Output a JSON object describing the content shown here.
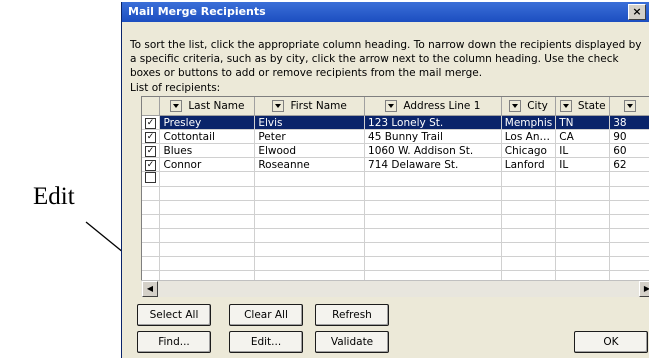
{
  "callout": {
    "text": "Edit"
  },
  "dialog": {
    "title": "Mail Merge Recipients",
    "close": "×",
    "instructions": "To sort the list, click the appropriate column heading.  To narrow down the recipients displayed by a specific criteria, such as by city, click the arrow next to the column heading.  Use the check boxes or buttons to add or remove recipients from the mail merge.",
    "list_label": "List of recipients:",
    "columns": [
      "Last Name",
      "First Name",
      "Address Line 1",
      "City",
      "State",
      ""
    ],
    "rows": [
      {
        "checked": true,
        "last": "Presley",
        "first": "Elvis",
        "address": "123 Lonely St.",
        "city": "Memphis",
        "state": "TN",
        "zip": "38"
      },
      {
        "checked": true,
        "last": "Cottontail",
        "first": "Peter",
        "address": "45 Bunny Trail",
        "city": "Los An…",
        "state": "CA",
        "zip": "90"
      },
      {
        "checked": true,
        "last": "Blues",
        "first": "Elwood",
        "address": "1060 W. Addison St.",
        "city": "Chicago",
        "state": "IL",
        "zip": "60"
      },
      {
        "checked": true,
        "last": "Connor",
        "first": "Roseanne",
        "address": "714 Delaware St.",
        "city": "Lanford",
        "state": "IL",
        "zip": "62"
      },
      {
        "checked": false,
        "last": "",
        "first": "",
        "address": "",
        "city": "",
        "state": "",
        "zip": ""
      }
    ],
    "buttons": {
      "select_all": "Select All",
      "clear_all": "Clear All",
      "refresh": "Refresh",
      "find": "Find...",
      "edit": "Edit...",
      "validate": "Validate",
      "ok": "OK"
    },
    "check_glyph": "✓",
    "scroll_left": "◀",
    "scroll_right": "▶"
  }
}
